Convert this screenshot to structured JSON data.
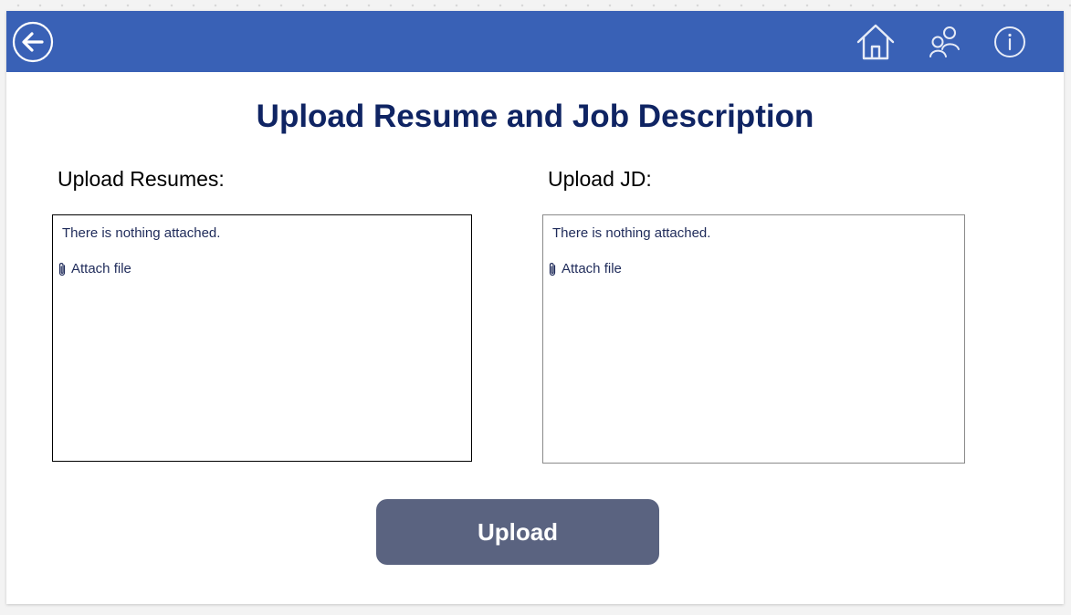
{
  "header": {
    "back_icon": "back-arrow-icon",
    "home_icon": "home-icon",
    "users_icon": "users-icon",
    "info_icon": "info-icon",
    "background_color": "#3961b6"
  },
  "page": {
    "title": "Upload Resume and Job Description"
  },
  "resumes": {
    "label": "Upload Resumes:",
    "empty_text": "There is nothing attached.",
    "attach_label": "Attach file"
  },
  "jd": {
    "label": "Upload JD:",
    "empty_text": "There is nothing attached.",
    "attach_label": "Attach file"
  },
  "actions": {
    "upload_label": "Upload",
    "upload_color": "#5a6380"
  },
  "colors": {
    "title": "#0f2463",
    "body_text": "#1f2b5a"
  }
}
